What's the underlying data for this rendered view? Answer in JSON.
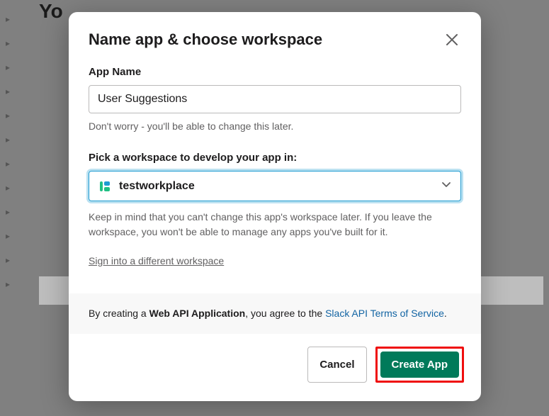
{
  "background": {
    "title_fragment": "Yo"
  },
  "modal": {
    "title": "Name app & choose workspace",
    "app_name_label": "App Name",
    "app_name_value": "User Suggestions",
    "app_name_help": "Don't worry - you'll be able to change this later.",
    "workspace_label": "Pick a workspace to develop your app in:",
    "workspace_selected": "testworkplace",
    "workspace_note": "Keep in mind that you can't change this app's workspace later. If you leave the workspace, you won't be able to manage any apps you've built for it.",
    "signin_link": "Sign into a different workspace",
    "agree_prefix": "By creating a ",
    "agree_bold": "Web API Application",
    "agree_mid": ", you agree to the ",
    "agree_link": "Slack API Terms of Service",
    "agree_suffix": ".",
    "cancel_label": "Cancel",
    "create_label": "Create App"
  }
}
